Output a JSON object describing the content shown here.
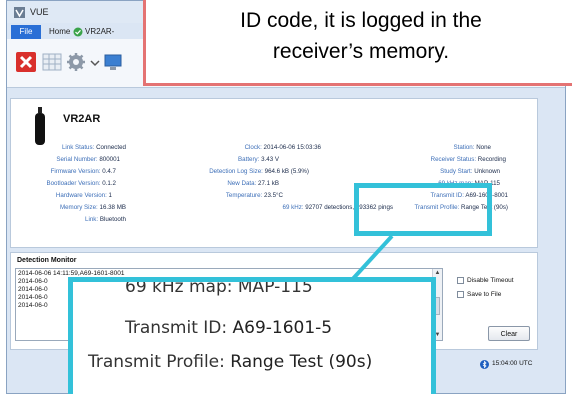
{
  "app": {
    "title": "VUE"
  },
  "ribbon_tabs": {
    "file": "File",
    "home": "Home",
    "device": "VR2AR-"
  },
  "device": {
    "name": "VR2AR",
    "fields": {
      "link_status": {
        "label": "Link Status:",
        "value": "Connected"
      },
      "serial_number": {
        "label": "Serial Number:",
        "value": "800001"
      },
      "firmware_version": {
        "label": "Firmware Version:",
        "value": "0.4.7"
      },
      "bootloader_version": {
        "label": "Bootloader Version:",
        "value": "0.1.2"
      },
      "hardware_version": {
        "label": "Hardware Version:",
        "value": "1"
      },
      "memory_size": {
        "label": "Memory Size:",
        "value": "16.38 MB"
      },
      "link": {
        "label": "Link:",
        "value": "Bluetooth"
      },
      "clock": {
        "label": "Clock:",
        "value": "2014-06-06 15:03:36"
      },
      "battery": {
        "label": "Battery:",
        "value": "3.43 V"
      },
      "detection_log_size": {
        "label": "Detection Log Size:",
        "value": "964.6 kB (5.9%)"
      },
      "new_data": {
        "label": "New Data:",
        "value": "27.1 kB"
      },
      "temperature": {
        "label": "Temperature:",
        "value": "23.5°C"
      },
      "khz69": {
        "label": "69 kHz:",
        "value": "92707 detections, 793362 pings"
      },
      "station": {
        "label": "Station:",
        "value": "None"
      },
      "receiver_status": {
        "label": "Receiver Status:",
        "value": "Recording"
      },
      "study_start": {
        "label": "Study Start:",
        "value": "Unknown"
      },
      "map_69khz": {
        "label": "69 kHz map:",
        "value": "MAP-115"
      },
      "transmit_id": {
        "label": "Transmit ID:",
        "value": "A69-1601-8001"
      },
      "transmit_profile": {
        "label": "Transmit Profile:",
        "value": "Range Test (90s)"
      }
    }
  },
  "monitor": {
    "title": "Detection Monitor",
    "log_lines": [
      "2014-06-06 14:11:59,A69-1601-8001",
      "2014-06-0",
      "2014-06-0",
      "2014-06-0",
      "2014-06-0"
    ],
    "disable_timeout": "Disable Timeout",
    "save_to_file": "Save to File",
    "clear_label": "Clear"
  },
  "status": {
    "time": "15:04:00 UTC"
  },
  "callout": {
    "caption_line1": "ID code, it is logged in the",
    "caption_line2": "receiver’s memory."
  },
  "zoom": {
    "map_line": "69 kHz map: MAP-115",
    "transmit_id_label": "Transmit ID:",
    "transmit_id_value": "A69-1601-5",
    "transmit_profile_label": "Transmit Profile:",
    "transmit_profile_value": "Range Test (90s)"
  },
  "colors": {
    "highlight": "#33c1d9",
    "callout_border": "#e47373",
    "label_blue": "#3d6fb8"
  }
}
